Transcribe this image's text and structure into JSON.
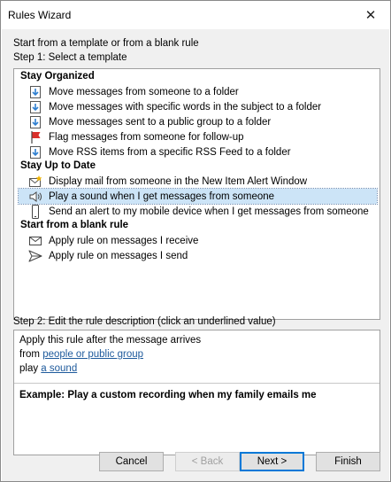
{
  "window": {
    "title": "Rules Wizard",
    "close_label": "✕"
  },
  "intro": "Start from a template or from a blank rule",
  "step1_label": "Step 1: Select a template",
  "groups": [
    {
      "title": "Stay Organized",
      "items": [
        {
          "label": "Move messages from someone to a folder",
          "icon": "move-to-folder-icon"
        },
        {
          "label": "Move messages with specific words in the subject to a folder",
          "icon": "move-to-folder-icon"
        },
        {
          "label": "Move messages sent to a public group to a folder",
          "icon": "move-to-folder-icon"
        },
        {
          "label": "Flag messages from someone for follow-up",
          "icon": "red-flag-icon"
        },
        {
          "label": "Move RSS items from a specific RSS Feed to a folder",
          "icon": "move-to-folder-icon"
        }
      ]
    },
    {
      "title": "Stay Up to Date",
      "items": [
        {
          "label": "Display mail from someone in the New Item Alert Window",
          "icon": "new-item-alert-icon"
        },
        {
          "label": "Play a sound when I get messages from someone",
          "icon": "speaker-icon",
          "selected": true
        },
        {
          "label": "Send an alert to my mobile device when I get messages from someone",
          "icon": "mobile-phone-icon"
        }
      ]
    },
    {
      "title": "Start from a blank rule",
      "items": [
        {
          "label": "Apply rule on messages I receive",
          "icon": "envelope-icon"
        },
        {
          "label": "Apply rule on messages I send",
          "icon": "send-arrow-icon"
        }
      ]
    }
  ],
  "step2_label": "Step 2: Edit the rule description (click an underlined value)",
  "description": {
    "line1": "Apply this rule after the message arrives",
    "line2_prefix": "from ",
    "line2_link": "people or public group",
    "line3_prefix": "play ",
    "line3_link": "a sound",
    "example": "Example: Play a custom recording when my family emails me"
  },
  "buttons": {
    "cancel": "Cancel",
    "back": "< Back",
    "next": "Next >",
    "finish": "Finish"
  },
  "colors": {
    "selection": "#cce4f7",
    "link": "#1e5a9c",
    "flag": "#d9302b",
    "folder_arrow": "#2f7fd0"
  }
}
